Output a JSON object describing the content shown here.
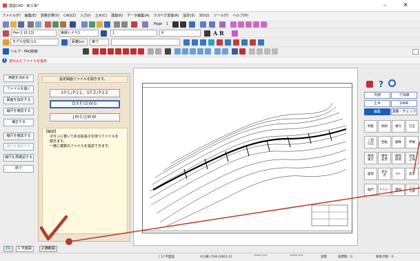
{
  "window": {
    "title": "建設CAD - 新工事*",
    "min": "–",
    "close": "✕"
  },
  "menu": [
    "ファイル(F)",
    "編集(E)",
    "測量計算(V)",
    "CAD(Z)",
    "入力(I)",
    "土木(C)",
    "建築(K)",
    "データ編集(A)",
    "ラスベク変換(R)",
    "設定(S)",
    "3D(Q)",
    "ツール(T)",
    "ヘルプ(H)"
  ],
  "toolbar1": {
    "page_label": "Page",
    "page_num": "1"
  },
  "toolbar2": {
    "pen": "Pen 1 [0.13]",
    "line": "実線レイヤ1",
    "layer": "1",
    "layer2": "8"
  },
  "toolbar3": {
    "model": "モデル空間 1/1",
    "unit": "距離&m",
    "zoom": "実寸"
  },
  "toolbar4": {
    "help": "ヘルプ・FAQ検索"
  },
  "notice": "読み込むファイルを指定",
  "left_buttons": [
    "用紙を決める",
    "ファイルを開く",
    "図面を指定する",
    "縮尺を確認する",
    "補正する",
    "縮尺を確認する",
    "異尺を確認する",
    "縮尺を再確認する",
    "終了"
  ],
  "mid": {
    "head": "設定図面ファイルを開きます。",
    "btn1": "SFC/P21, SFZ/P2Z",
    "btn2": "DXF/DWG",
    "btn3": "JWC/JWW",
    "help_title": "【解説】",
    "help_lines": [
      "ボタンに書いてある拡張子を持つファイルを",
      "開きます。",
      "一度に複数のファイルを指定できます。"
    ]
  },
  "right": {
    "tabs": [
      "汎用",
      "寸法線",
      "土木",
      "DWR",
      "編集",
      "測量・チェック"
    ],
    "grid": [
      "移動",
      "削除",
      "複写",
      "訂正",
      "一括\n訂正",
      "回転",
      "鏡像",
      "伸縮",
      "属性\n複写",
      "属性\n変更",
      "属性\n取得",
      "延長\n止揃",
      "面取",
      "変化\n点",
      "ｶｯﾄ",
      "変形",
      "縮尺",
      "ｸﾞﾘｯﾄﾞ",
      "重換",
      "ﾊﾞﾗ\n写真"
    ]
  },
  "tabs": [
    "ﾌﾘｰ",
    "1 平面図",
    "2 横断図"
  ],
  "status": {
    "s1": "[ 1] 平面図",
    "s2": "A1(横) [594.0/801.0]",
    "s3": "*****.***",
    "s4": "*****.***",
    "s5": "測量",
    "s6": "座標数：0",
    "s7": "要素点数：0"
  },
  "colors": {
    "accent": "#1a5fb4",
    "notice": "#cc0000",
    "annotation": "#b23b2a"
  }
}
